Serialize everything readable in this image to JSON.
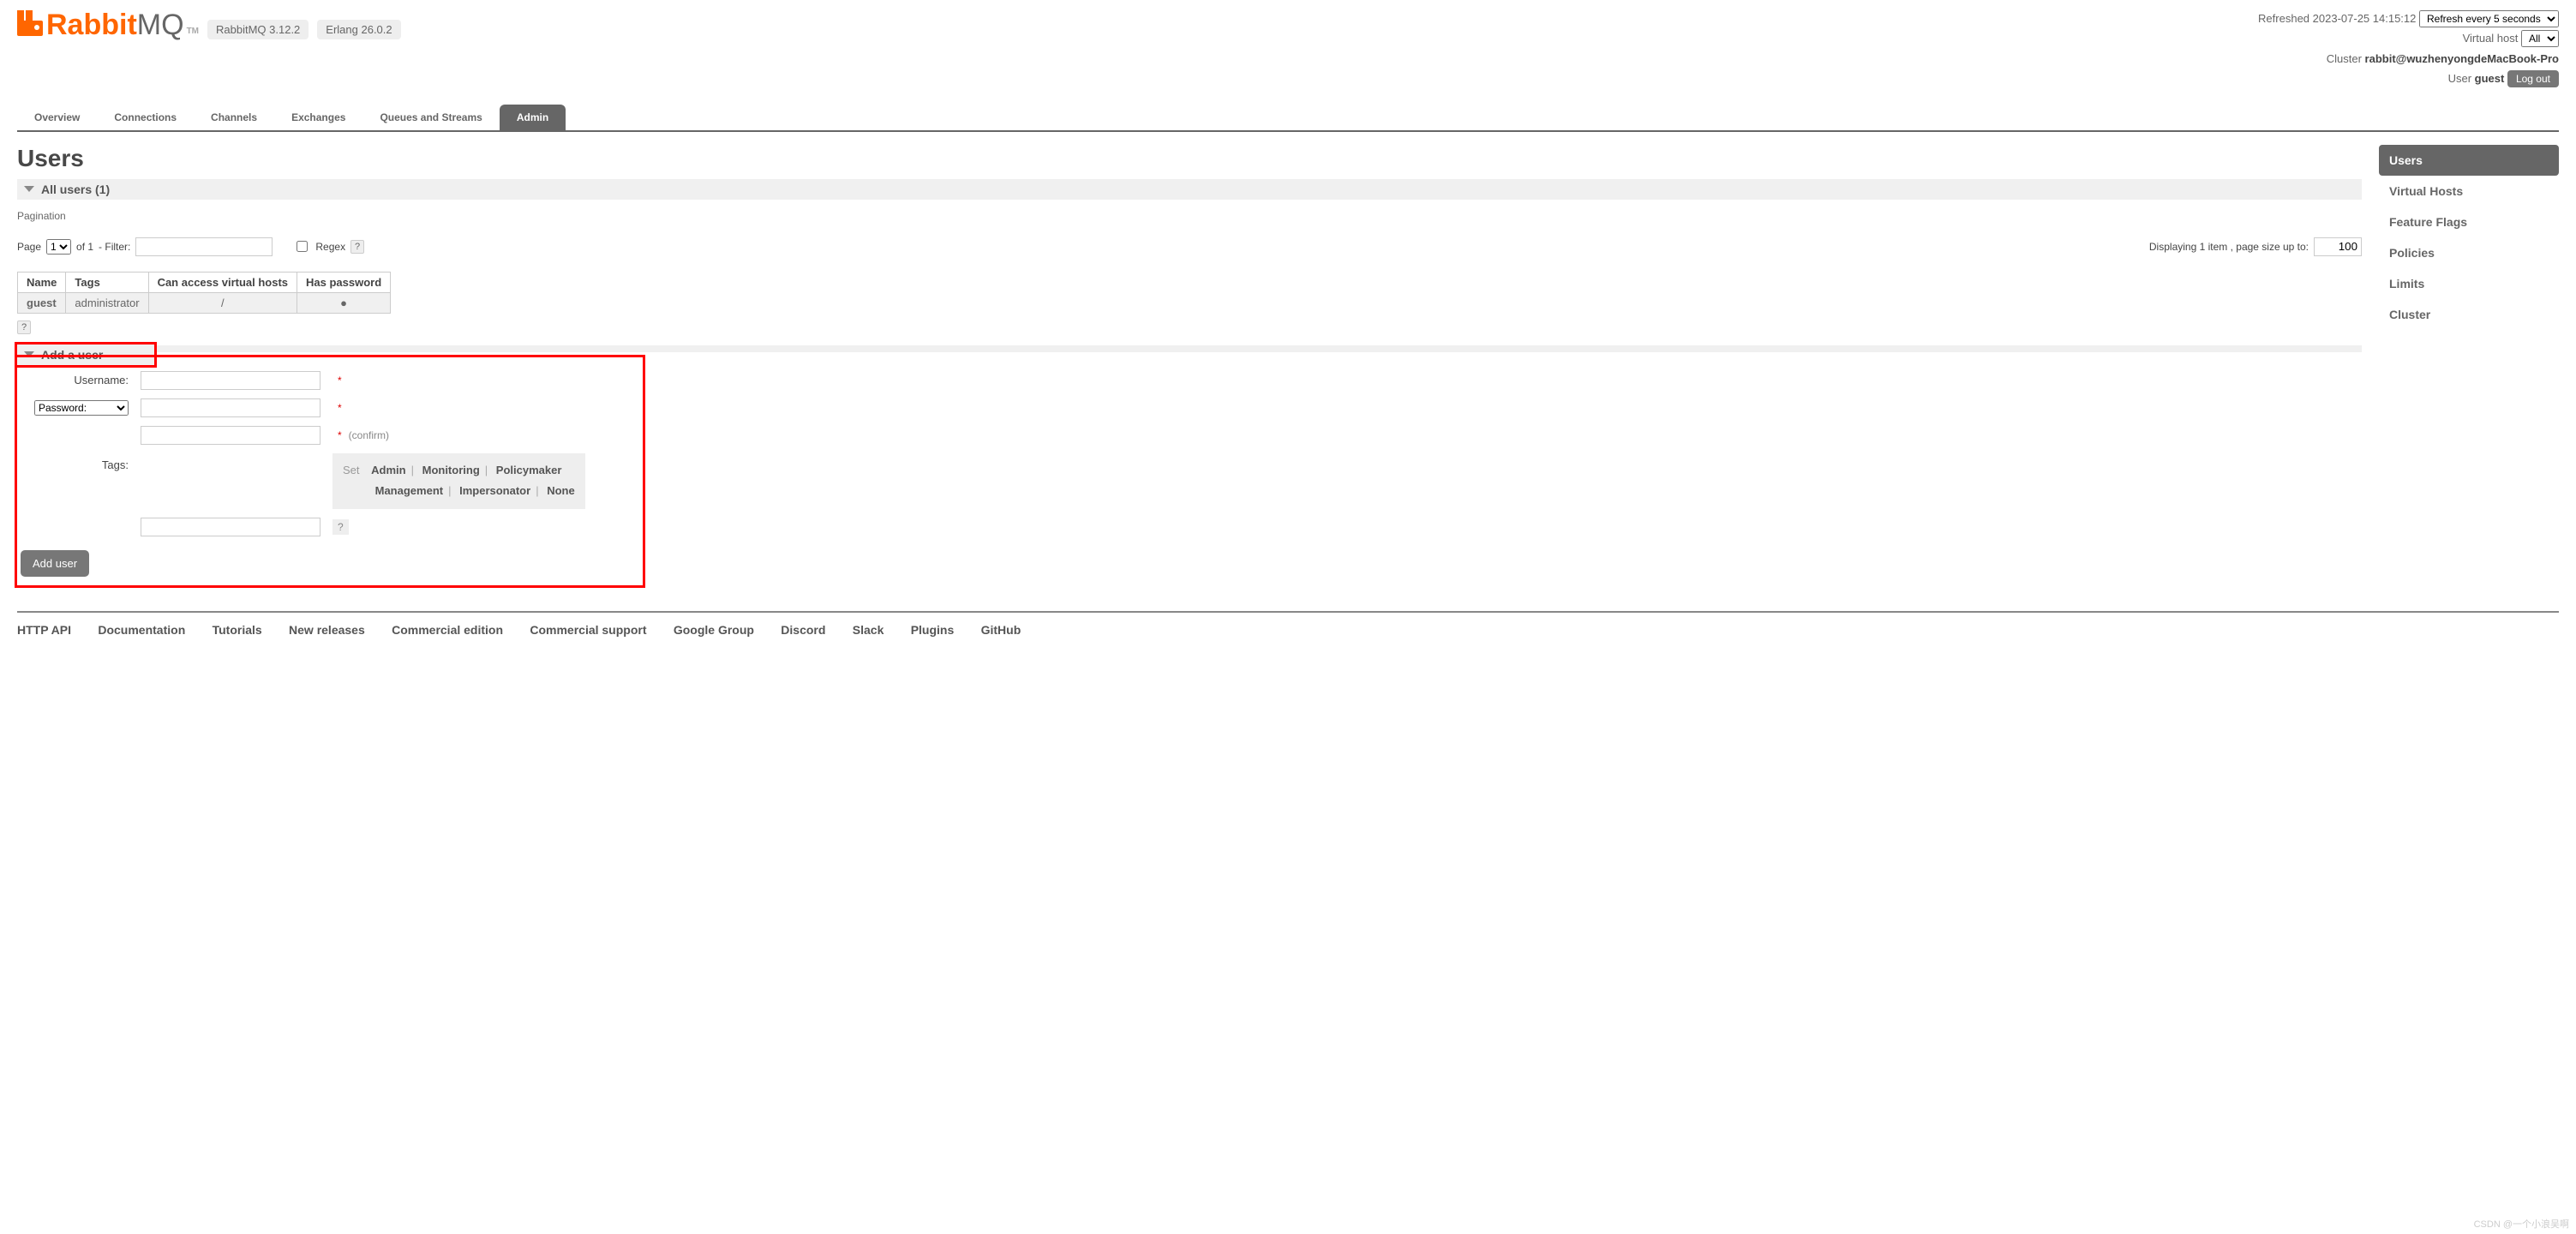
{
  "header": {
    "brand": "Rabbit",
    "brand2": "MQ",
    "tm": "TM",
    "version_pill": "RabbitMQ 3.12.2",
    "erlang_pill": "Erlang 26.0.2",
    "refreshed_label": "Refreshed",
    "refreshed_time": "2023-07-25 14:15:12",
    "refresh_select": "Refresh every 5 seconds",
    "vhost_label": "Virtual host",
    "vhost_select": "All",
    "cluster_label": "Cluster",
    "cluster_name": "rabbit@wuzhenyongdeMacBook-Pro",
    "user_label": "User",
    "user_name": "guest",
    "logout": "Log out"
  },
  "tabs": [
    "Overview",
    "Connections",
    "Channels",
    "Exchanges",
    "Queues and Streams",
    "Admin"
  ],
  "active_tab": "Admin",
  "rhs": [
    "Users",
    "Virtual Hosts",
    "Feature Flags",
    "Policies",
    "Limits",
    "Cluster"
  ],
  "rhs_active": "Users",
  "page": {
    "title": "Users",
    "all_users_label": "All users (1)",
    "pagination_label": "Pagination",
    "page_label": "Page",
    "page_select": "1",
    "of_label": "of 1",
    "filter_label": "- Filter:",
    "regex_label": "Regex",
    "regex_help": "?",
    "displaying_text": "Displaying 1 item , page size up to:",
    "page_size": "100"
  },
  "users_table": {
    "headers": [
      "Name",
      "Tags",
      "Can access virtual hosts",
      "Has password"
    ],
    "rows": [
      {
        "name": "guest",
        "tags": "administrator",
        "vhosts": "/",
        "has_pw": "●"
      }
    ]
  },
  "help_q": "?",
  "add_user": {
    "section": "Add a user",
    "username_label": "Username:",
    "password_select": "Password:",
    "confirm_label": "(confirm)",
    "tags_label": "Tags:",
    "set_label": "Set",
    "tag_options": [
      "Admin",
      "Monitoring",
      "Policymaker",
      "Management",
      "Impersonator",
      "None"
    ],
    "qmark": "?",
    "submit": "Add user"
  },
  "footer": [
    "HTTP API",
    "Documentation",
    "Tutorials",
    "New releases",
    "Commercial edition",
    "Commercial support",
    "Google Group",
    "Discord",
    "Slack",
    "Plugins",
    "GitHub"
  ],
  "watermark": "CSDN @一个小浪吴啊"
}
